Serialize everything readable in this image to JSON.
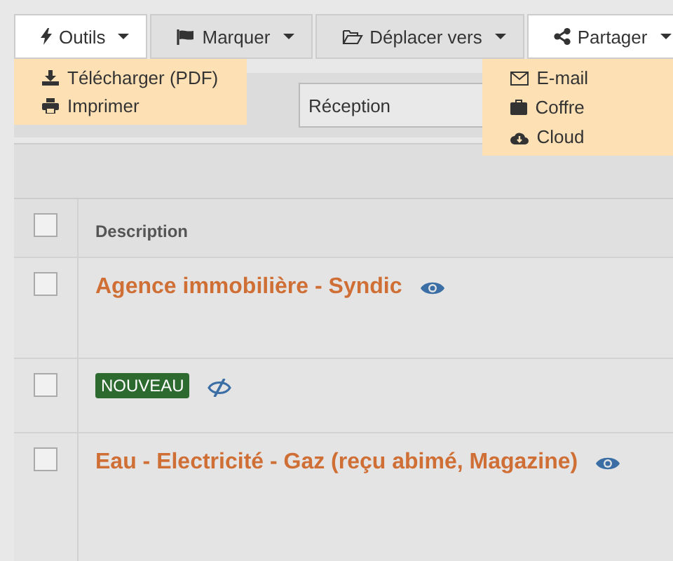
{
  "toolbar": [
    {
      "label": "Outils",
      "open": true,
      "menu": [
        {
          "label": "Télécharger (PDF)"
        },
        {
          "label": "Imprimer"
        }
      ]
    },
    {
      "label": "Marquer",
      "open": false
    },
    {
      "label": "Déplacer vers",
      "open": false
    },
    {
      "label": "Partager",
      "open": true,
      "menu": [
        {
          "label": "E-mail"
        },
        {
          "label": "Coffre"
        },
        {
          "label": "Cloud"
        }
      ]
    }
  ],
  "folder_select": {
    "value": "Réception"
  },
  "table": {
    "header_checked": false,
    "columns": [
      "Description"
    ],
    "rows": [
      {
        "kind": "title",
        "text": "Agence immobilière - Syndic",
        "checked": false,
        "seen": true
      },
      {
        "kind": "badge",
        "text": "NOUVEAU",
        "checked": false,
        "seen": false
      },
      {
        "kind": "title",
        "text": "Eau - Electricité - Gaz (reçu abimé, Magazine)",
        "checked": false,
        "seen": true
      }
    ]
  }
}
